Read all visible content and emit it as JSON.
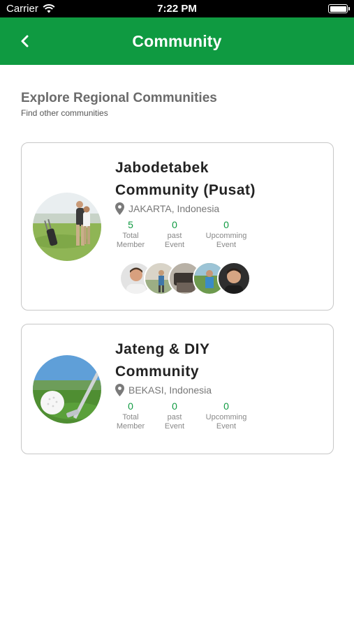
{
  "status_bar": {
    "carrier": "Carrier",
    "time": "7:22 PM"
  },
  "app_bar": {
    "title": "Community"
  },
  "section": {
    "heading": "Explore Regional Communities",
    "subheading": "Find other communities"
  },
  "communities": [
    {
      "name_line1": "Jabodetabek",
      "name_line2": "Community (Pusat)",
      "location": "JAKARTA, Indonesia",
      "stats": [
        {
          "value": "5",
          "label1": "Total",
          "label2": "Member"
        },
        {
          "value": "0",
          "label1": "past",
          "label2": "Event"
        },
        {
          "value": "0",
          "label1": "Upcomming",
          "label2": "Event"
        }
      ]
    },
    {
      "name_line1": "Jateng & DIY",
      "name_line2": "Community",
      "location": "BEKASI, Indonesia",
      "stats": [
        {
          "value": "0",
          "label1": "Total",
          "label2": "Member"
        },
        {
          "value": "0",
          "label1": "past",
          "label2": "Event"
        },
        {
          "value": "0",
          "label1": "Upcomming",
          "label2": "Event"
        }
      ]
    }
  ],
  "colors": {
    "brand": "#0f9a41",
    "card_border": "#c7c7c7"
  }
}
